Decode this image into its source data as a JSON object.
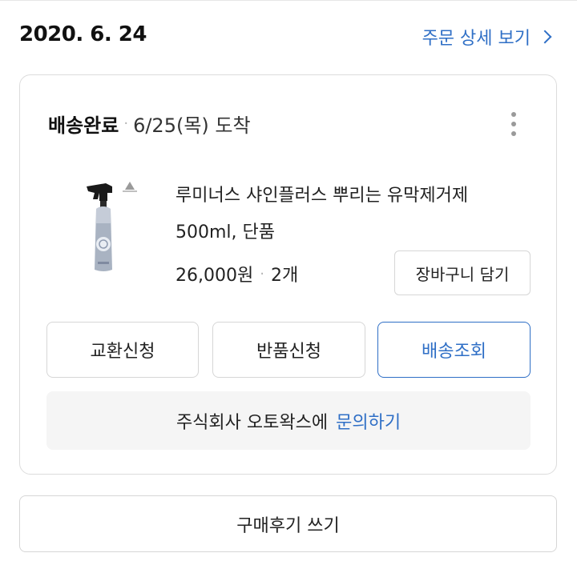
{
  "order": {
    "date": "2020. 6. 24",
    "detail_link_label": "주문 상세 보기"
  },
  "delivery": {
    "status": "배송완료",
    "arrival": "6/25(목) 도착"
  },
  "product": {
    "name": "루미너스 샤인플러스 뿌리는 유막제거제 500ml, 단품",
    "price": "26,000원",
    "quantity": "2개",
    "add_to_cart_label": "장바구니 담기"
  },
  "actions": {
    "exchange_label": "교환신청",
    "return_label": "반품신청",
    "tracking_label": "배송조회"
  },
  "inquiry": {
    "seller_text": "주식회사 오토왁스에",
    "link_label": "문의하기"
  },
  "review": {
    "label": "구매후기 쓰기"
  },
  "colors": {
    "accent": "#2f6fc6",
    "border": "#d6d6d6",
    "inquiry_bg": "#f5f5f5"
  },
  "icons": {
    "detail_chevron": "chevron-right-icon",
    "more_menu": "more-vertical-icon"
  }
}
